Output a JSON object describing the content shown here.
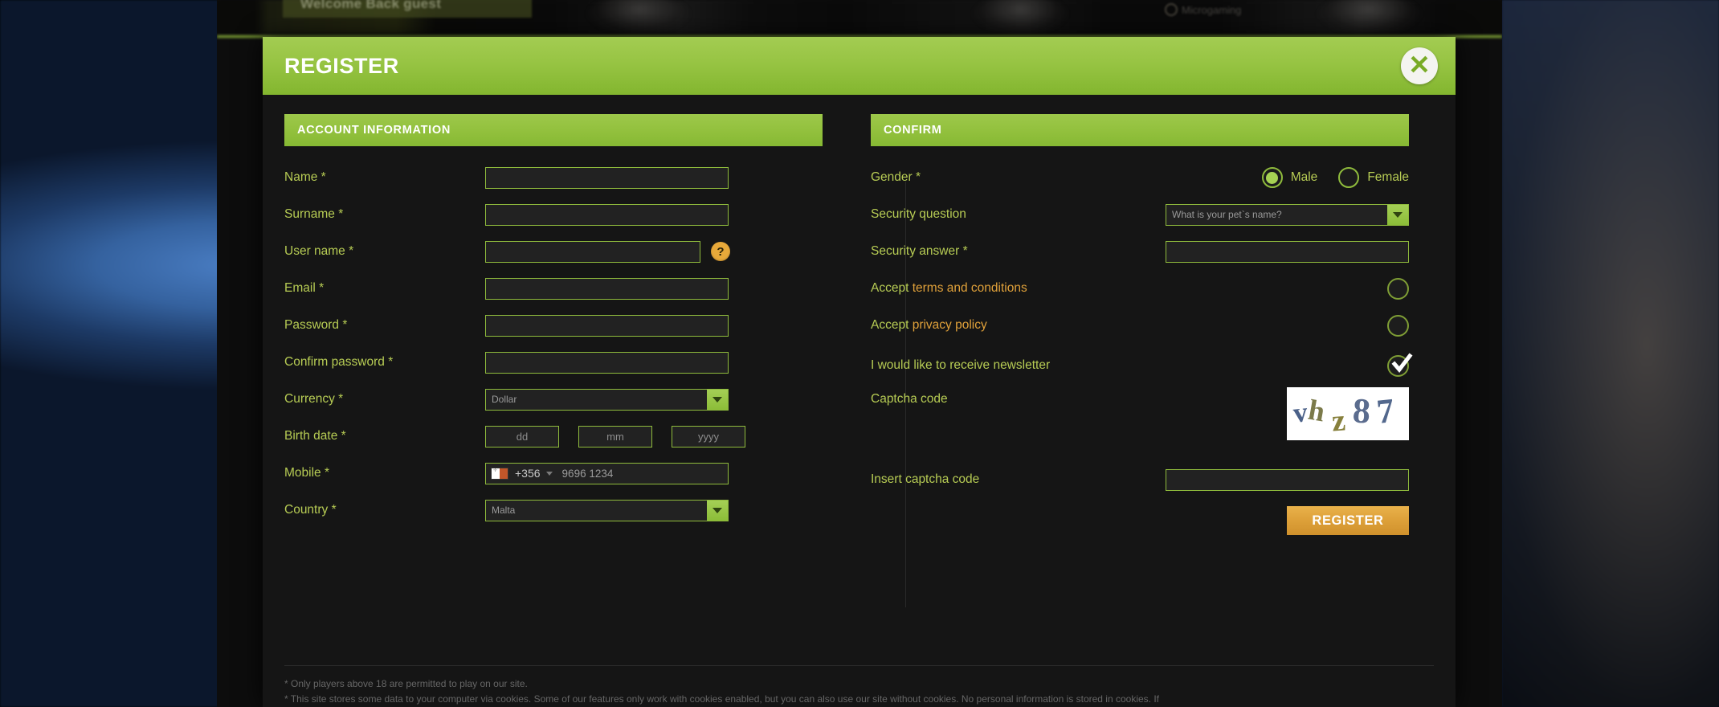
{
  "backdrop": {
    "welcome_text": "Welcome Back guest",
    "provider_logo_text": "Microgaming"
  },
  "modal": {
    "title": "REGISTER",
    "close_icon_glyph": "✕"
  },
  "account_section": {
    "header": "ACCOUNT INFORMATION",
    "fields": {
      "name_label": "Name *",
      "name_value": "",
      "surname_label": "Surname *",
      "surname_value": "",
      "username_label": "User name *",
      "username_value": "",
      "username_help_glyph": "?",
      "email_label": "Email *",
      "email_value": "",
      "password_label": "Password *",
      "password_value": "",
      "confirm_password_label": "Confirm password *",
      "confirm_password_value": "",
      "currency_label": "Currency *",
      "currency_value": "Dollar",
      "birthdate_label": "Birth date *",
      "birth_day_placeholder": "dd",
      "birth_month_placeholder": "mm",
      "birth_year_placeholder": "yyyy",
      "mobile_label": "Mobile *",
      "mobile_dial_code": "+356",
      "mobile_flag": "malta-flag-icon",
      "mobile_placeholder": "9696 1234",
      "country_label": "Country *",
      "country_value": "Malta"
    }
  },
  "confirm_section": {
    "header": "CONFIRM",
    "gender_label": "Gender *",
    "gender_male_label": "Male",
    "gender_female_label": "Female",
    "gender_selected": "Male",
    "security_question_label": "Security question",
    "security_question_value": "What is your pet`s name?",
    "security_answer_label": "Security answer *",
    "security_answer_value": "",
    "accept_terms_prefix": "Accept ",
    "accept_terms_link": "terms and conditions",
    "accept_terms_checked": false,
    "accept_privacy_prefix": "Accept ",
    "accept_privacy_link": "privacy policy",
    "accept_privacy_checked": false,
    "newsletter_label": "I would like to receive newsletter",
    "newsletter_checked": true,
    "captcha_label": "Captcha code",
    "captcha_chars": [
      "v",
      "h",
      "z",
      "8",
      "7"
    ],
    "captcha_text": "vhz87",
    "insert_captcha_label": "Insert captcha code",
    "insert_captcha_value": "",
    "register_button": "REGISTER"
  },
  "footer": {
    "line1": "* Only players above 18 are permitted to play on our site.",
    "line2": "* This site stores some data to your computer via cookies. Some of our features only work with cookies enabled, but you can also use our site without cookies. No personal information is stored in cookies. If"
  },
  "colors": {
    "brand_green": "#93c13e",
    "label_green": "#b7cc54",
    "link_orange": "#e0a13a",
    "button_orange": "#dda039",
    "panel_dark": "#151515",
    "input_dark": "#222222"
  }
}
